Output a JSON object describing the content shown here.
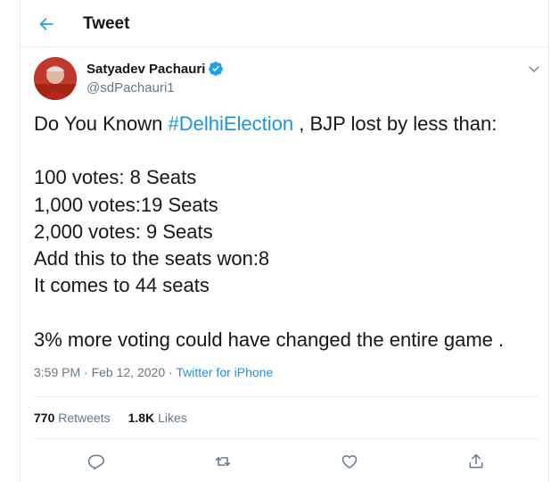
{
  "header": {
    "title": "Tweet"
  },
  "tweet": {
    "author_name": "Satyadev Pachauri",
    "author_handle": "@sdPachauri1",
    "line1_prefix": "Do You Known ",
    "line1_hashtag": "#DelhiElection",
    "line1_suffix": " , BJP lost by less than:",
    "line3": "100 votes: 8 Seats",
    "line4": "1,000 votes:19 Seats",
    "line5": "2,000 votes: 9 Seats",
    "line6": "Add this to the seats won:8",
    "line7": "It comes to 44 seats",
    "line9": "3% more voting could have changed the entire game .",
    "time": "3:59 PM",
    "date": "Feb 12, 2020",
    "source": "Twitter for iPhone",
    "retweets_count": "770",
    "retweets_label": "Retweets",
    "likes_count": "1.8K",
    "likes_label": "Likes"
  },
  "colors": {
    "accent": "#1b95e0",
    "muted": "#657786",
    "text": "#14171a"
  }
}
